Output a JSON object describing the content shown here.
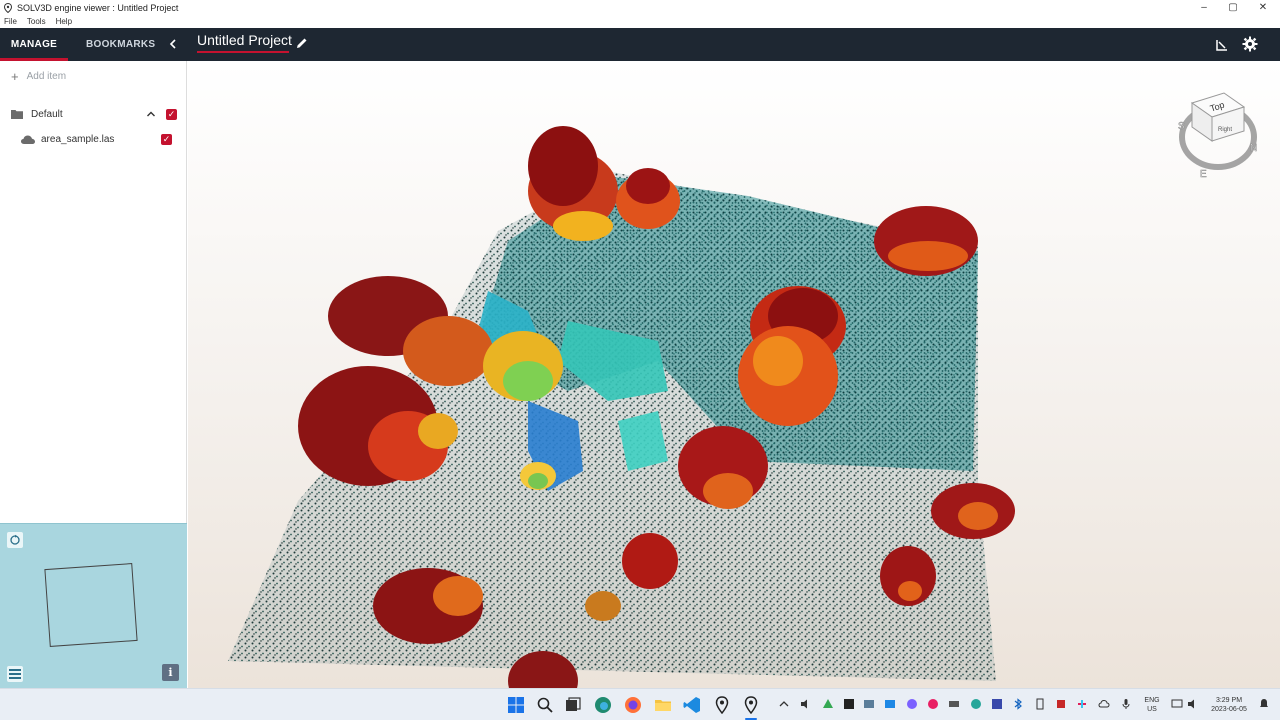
{
  "window": {
    "title": "SOLV3D engine viewer : Untitled Project",
    "controls": {
      "minimize": "–",
      "maximize": "▢",
      "close": "✕"
    }
  },
  "menu": {
    "items": [
      "File",
      "Tools",
      "Help"
    ]
  },
  "header": {
    "tabs": [
      {
        "label": "MANAGE",
        "active": true
      },
      {
        "label": "BOOKMARKS",
        "active": false
      }
    ],
    "project_title": "Untitled Project",
    "accent_color": "#c4122f",
    "icons": [
      "chevron-left-icon",
      "pencil-icon",
      "ruler-icon",
      "gear-icon"
    ]
  },
  "sidebar": {
    "add_item_label": "Add item",
    "tree": [
      {
        "label": "Default",
        "type": "folder",
        "expanded": true,
        "checked": true
      },
      {
        "label": "area_sample.las",
        "type": "point-cloud",
        "checked": true
      }
    ]
  },
  "minimap": {
    "icons": [
      "reset-view-icon",
      "list-icon",
      "info-icon"
    ],
    "info_label": "i"
  },
  "navcube": {
    "face_top": "Top",
    "face_front": "Right",
    "compass": [
      "S",
      "N",
      "E"
    ]
  },
  "taskbar": {
    "language": "ENG",
    "region": "US",
    "time": "3:29 PM",
    "date": "2023-06-05",
    "icons": [
      "windows-start-icon",
      "search-icon",
      "task-view-icon",
      "edge-icon",
      "firefox-icon",
      "file-explorer-icon",
      "vscode-icon",
      "solv3d-icon",
      "solv3d-icon"
    ]
  }
}
